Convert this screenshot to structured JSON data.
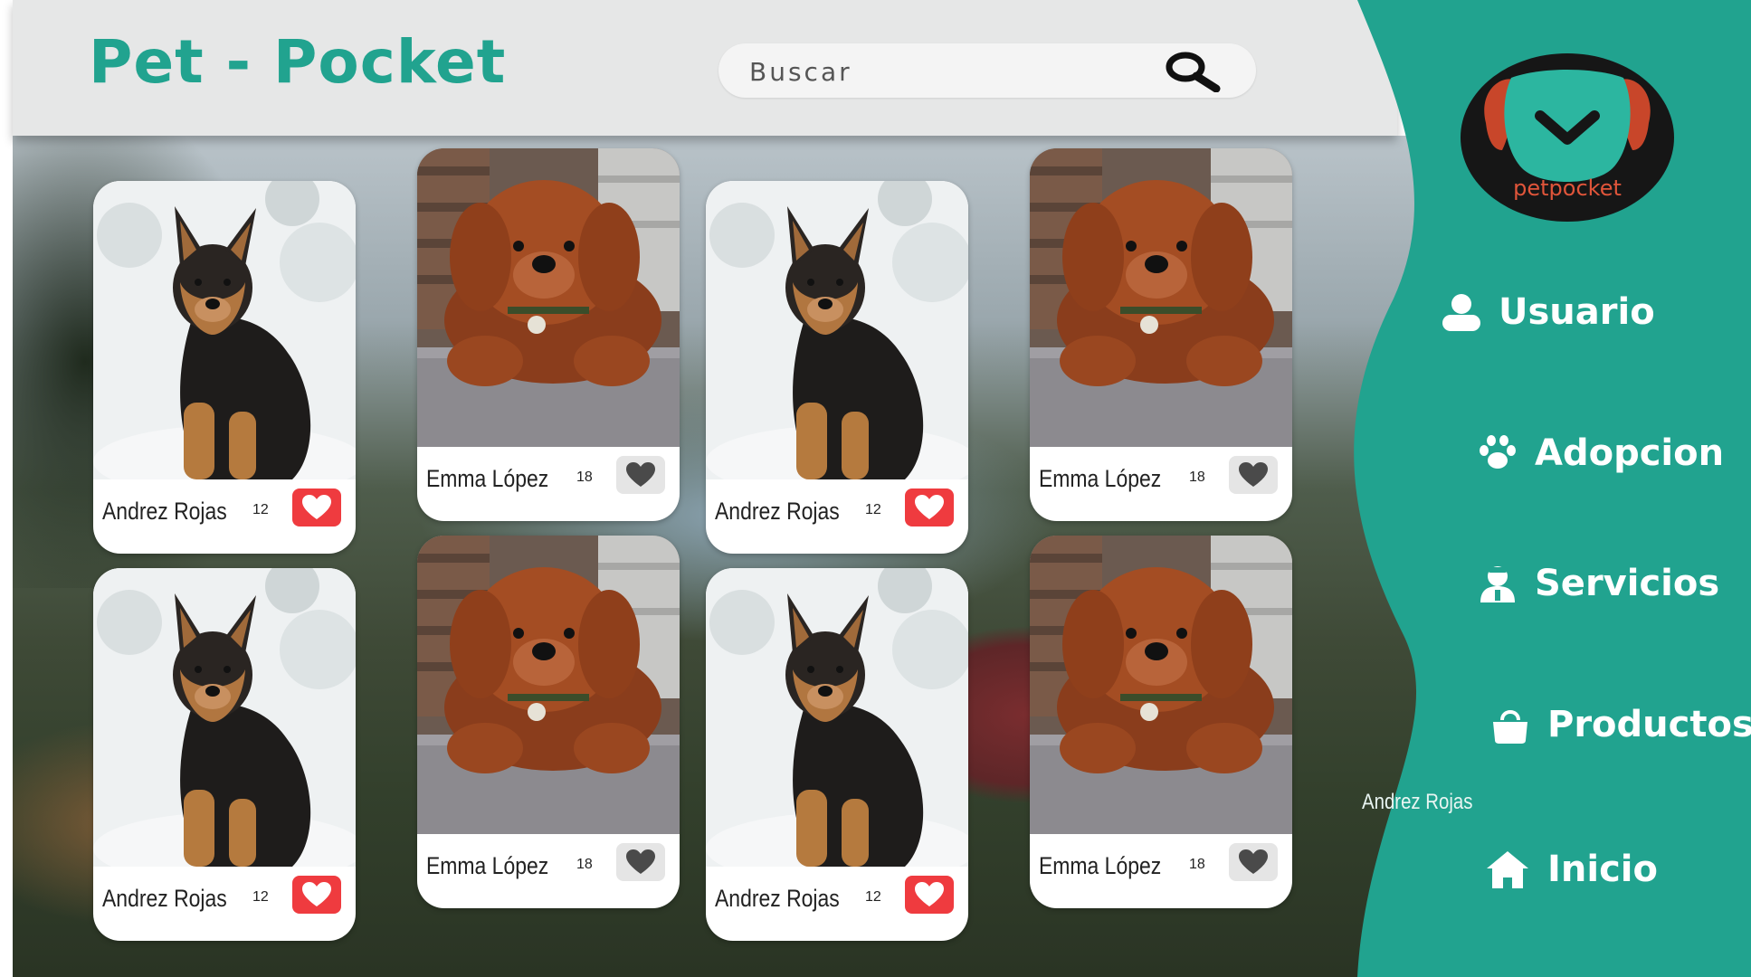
{
  "header": {
    "brand": "Pet - Pocket",
    "search_placeholder": "Buscar"
  },
  "sidebar": {
    "logo_text": "petpocket",
    "nav": [
      {
        "label": "Usuario",
        "icon": "user-icon"
      },
      {
        "label": "Adopcion",
        "icon": "paw-icon"
      },
      {
        "label": "Servicios",
        "icon": "service-person-icon"
      },
      {
        "label": "Productos",
        "icon": "shopping-bag-icon"
      },
      {
        "label": "Inicio",
        "icon": "home-icon"
      }
    ],
    "floating_name": "Andrez Rojas"
  },
  "cards": [
    {
      "owner": "Andrez Rojas",
      "likes": "12",
      "liked": true,
      "pet": "german-shepherd-puppy"
    },
    {
      "owner": "Emma López",
      "likes": "18",
      "liked": false,
      "pet": "brown-doodle-puppy"
    },
    {
      "owner": "Andrez Rojas",
      "likes": "12",
      "liked": true,
      "pet": "german-shepherd-puppy"
    },
    {
      "owner": "Emma López",
      "likes": "18",
      "liked": false,
      "pet": "brown-doodle-puppy"
    },
    {
      "owner": "Andrez Rojas",
      "likes": "12",
      "liked": true,
      "pet": "german-shepherd-puppy"
    },
    {
      "owner": "Emma López",
      "likes": "18",
      "liked": false,
      "pet": "brown-doodle-puppy"
    },
    {
      "owner": "Andrez Rojas",
      "likes": "12",
      "liked": true,
      "pet": "german-shepherd-puppy"
    },
    {
      "owner": "Emma López",
      "likes": "18",
      "liked": false,
      "pet": "brown-doodle-puppy"
    }
  ],
  "colors": {
    "brand": "#21a38f",
    "sidebar": "#21a38f",
    "like_active": "#ef3b3f",
    "like_inactive": "#e5e5e5"
  }
}
